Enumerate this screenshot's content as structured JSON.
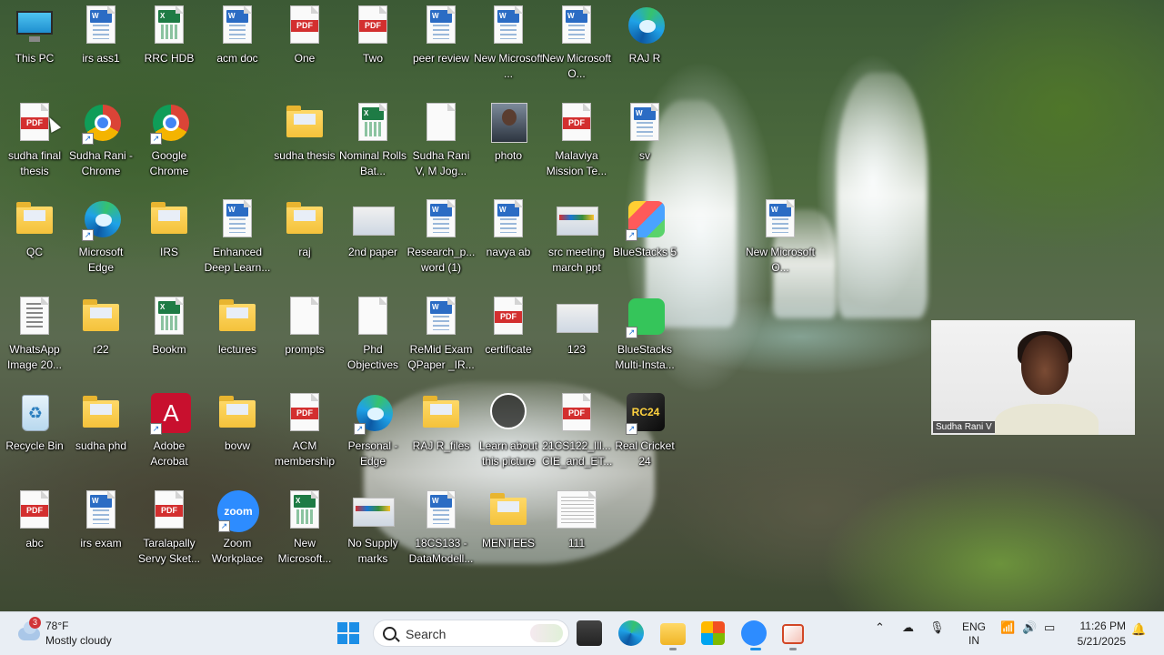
{
  "desktop": {
    "icons": [
      {
        "label": "This PC"
      },
      {
        "label": "irs ass1"
      },
      {
        "label": "RRC HDB"
      },
      {
        "label": "acm doc"
      },
      {
        "label": "One"
      },
      {
        "label": "Two"
      },
      {
        "label": "peer review"
      },
      {
        "label": "New Microsoft ..."
      },
      {
        "label": "New Microsoft O..."
      },
      {
        "label": "RAJ R"
      },
      {
        "label": "sudha final thesis"
      },
      {
        "label": "Sudha Rani - Chrome"
      },
      {
        "label": "Google Chrome"
      },
      {
        "label": "sudha thesis"
      },
      {
        "label": "Nominal Rolls Bat..."
      },
      {
        "label": "Sudha Rani V, M Jog..."
      },
      {
        "label": "photo"
      },
      {
        "label": "Malaviya Mission Te..."
      },
      {
        "label": "sv"
      },
      {
        "label": "QC"
      },
      {
        "label": "Microsoft Edge"
      },
      {
        "label": "IRS"
      },
      {
        "label": "Enhanced Deep Learn..."
      },
      {
        "label": "raj"
      },
      {
        "label": "2nd paper"
      },
      {
        "label": "Research_p... word (1)"
      },
      {
        "label": "navya ab"
      },
      {
        "label": "src meeting march ppt"
      },
      {
        "label": "BlueStacks 5"
      },
      {
        "label": "New Microsoft O..."
      },
      {
        "label": "WhatsApp Image 20..."
      },
      {
        "label": "r22"
      },
      {
        "label": "Bookm"
      },
      {
        "label": "lectures"
      },
      {
        "label": "prompts"
      },
      {
        "label": "Phd Objectives"
      },
      {
        "label": "ReMid Exam QPaper _IR..."
      },
      {
        "label": "certificate"
      },
      {
        "label": "123"
      },
      {
        "label": "BlueStacks Multi-Insta..."
      },
      {
        "label": "Recycle Bin"
      },
      {
        "label": "sudha phd"
      },
      {
        "label": "Adobe Acrobat"
      },
      {
        "label": "bovw"
      },
      {
        "label": "ACM membership"
      },
      {
        "label": "Personal - Edge"
      },
      {
        "label": "RAJ R_files"
      },
      {
        "label": "Learn about this picture"
      },
      {
        "label": "21CS122_Ill... CIE_and_ET..."
      },
      {
        "label": "Real Cricket 24"
      },
      {
        "label": "abc"
      },
      {
        "label": "irs exam"
      },
      {
        "label": "Taralapally Servy Sket..."
      },
      {
        "label": "Zoom Workplace"
      },
      {
        "label": "New Microsoft..."
      },
      {
        "label": "No Supply marks"
      },
      {
        "label": "18CS133 - DataModell..."
      },
      {
        "label": "MENTEES"
      },
      {
        "label": "111"
      }
    ]
  },
  "icon_badges": {
    "pdf": "PDF",
    "word": "W",
    "excel": "X",
    "zoom": "zoom",
    "cricket": "RC24",
    "acrobat": "A",
    "recycle": "♻"
  },
  "webcam": {
    "name": "Sudha Rani V"
  },
  "taskbar": {
    "weather": {
      "badge": "3",
      "temp": "78°F",
      "condition": "Mostly cloudy"
    },
    "search": {
      "label": "Search"
    },
    "apps": [
      "file-explorer-app",
      "edge-app",
      "folder-app",
      "microsoft-store-app",
      "zoom-app",
      "presentation-app"
    ],
    "language": {
      "line1": "ENG",
      "line2": "IN"
    },
    "clock": {
      "time": "11:26 PM",
      "date": "5/21/2025"
    }
  },
  "colors": {
    "accent": "#1c8ee6",
    "pdf_red": "#d32f2f",
    "taskbar_bg": "#e9eef4"
  }
}
